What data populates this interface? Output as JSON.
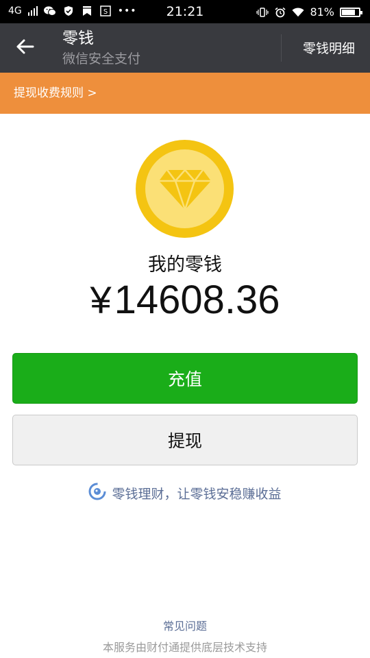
{
  "status_bar": {
    "network": "4G",
    "time": "21:21",
    "battery_percent": "81%",
    "battery_level": 0.81,
    "icons": [
      "signal-icon",
      "wechat-icon",
      "shield-icon",
      "bookmark-icon",
      "sohu-icon",
      "more-dots-icon",
      "vibrate-icon",
      "alarm-icon",
      "wifi-icon",
      "battery-icon"
    ],
    "more": "•••"
  },
  "nav": {
    "title": "零钱",
    "subtitle": "微信安全支付",
    "action": "零钱明细",
    "back_icon": "back-arrow-icon"
  },
  "notice": {
    "text": "提现收费规则 >"
  },
  "wallet": {
    "icon": "diamond-coin-icon",
    "label": "我的零钱",
    "currency": "¥",
    "amount": "14608.36"
  },
  "buttons": {
    "recharge": "充值",
    "withdraw": "提现"
  },
  "promo": {
    "text": "零钱理财，让零钱安稳赚收益",
    "icon": "licaitong-icon"
  },
  "footer": {
    "faq": "常见问题",
    "note": "本服务由财付通提供底层技术支持"
  },
  "colors": {
    "nav_bg": "#393a3f",
    "notice_bg": "#ee8f3c",
    "primary_green": "#1aad19",
    "coin_outer": "#f4c412",
    "coin_inner": "#fbe076",
    "link": "#5b6e96"
  }
}
